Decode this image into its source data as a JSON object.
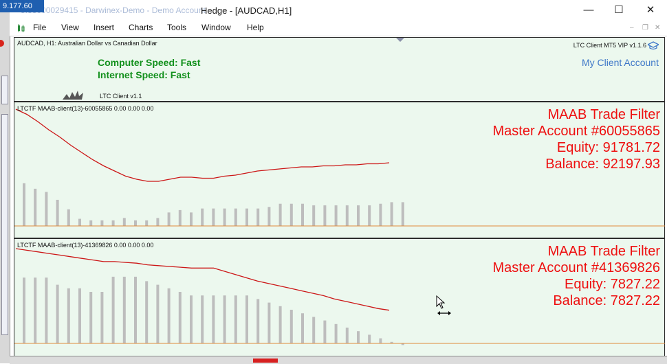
{
  "window": {
    "title": "Hedge - [AUDCAD,H1]",
    "background_caption": "5.33000029415 - Darwinex-Demo - Demo Account",
    "version_label": "9.177.60"
  },
  "menu": [
    "File",
    "View",
    "Insert",
    "Charts",
    "Tools",
    "Window",
    "Help"
  ],
  "top_panel": {
    "symbol": "AUDCAD, H1:  Australian Dollar vs Canadian Dollar",
    "client_version": "LTC Client MT5 VIP v1.1.6",
    "computer_speed": "Computer Speed: Fast",
    "internet_speed": "Internet Speed: Fast",
    "my_account_link": "My Client Account",
    "ltc_client": "LTC Client v1.1"
  },
  "subwindows": [
    {
      "indicator": "LTCTF MAAB-client(13)-60055865 0.00 0.00 0.00",
      "filter_title": "MAAB Trade Filter",
      "master": "Master Account #60055865",
      "equity": "Equity: 91781.72",
      "balance": "Balance: 92197.93"
    },
    {
      "indicator": "LTCTF MAAB-client(13)-41369826 0.00 0.00 0.00",
      "filter_title": "MAAB Trade Filter",
      "master": "Master Account #41369826",
      "equity": "Equity: 7827.22",
      "balance": "Balance: 7827.22"
    }
  ],
  "colors": {
    "panel_bg": "#ecf8ee",
    "red_text": "#ee1010",
    "green_text": "#12901c",
    "link_blue": "#3f78c8",
    "histogram": "#bdbdbd",
    "curve": "#cc1616",
    "level_line": "#e08a3a"
  },
  "chart_data": [
    {
      "type": "bar",
      "series": [
        {
          "values": [
            0.68,
            0.61,
            0.57,
            0.47,
            0.35,
            0.23,
            0.21,
            0.21,
            0.21,
            0.24,
            0.21,
            0.21,
            0.24,
            0.31,
            0.34,
            0.31,
            0.36,
            0.36,
            0.36,
            0.36,
            0.36,
            0.36,
            0.38,
            0.42,
            0.42,
            0.42,
            0.4,
            0.4,
            0.4,
            0.4,
            0.4,
            0.4,
            0.42,
            0.44,
            0.44
          ]
        },
        {
          "values": [
            1.0,
            0.95,
            0.88,
            0.8,
            0.73,
            0.65,
            0.58,
            0.51,
            0.45,
            0.4,
            0.35,
            0.32,
            0.3,
            0.3,
            0.32,
            0.34,
            0.34,
            0.33,
            0.33,
            0.35,
            0.36,
            0.38,
            0.4,
            0.41,
            0.42,
            0.43,
            0.44,
            0.44,
            0.45,
            0.45,
            0.46,
            0.46,
            0.47,
            0.47,
            0.48
          ]
        }
      ]
    },
    {
      "type": "bar",
      "series": [
        {
          "values": [
            0.86,
            0.86,
            0.86,
            0.78,
            0.74,
            0.74,
            0.7,
            0.7,
            0.87,
            0.87,
            0.87,
            0.82,
            0.78,
            0.74,
            0.7,
            0.66,
            0.66,
            0.66,
            0.66,
            0.66,
            0.66,
            0.62,
            0.58,
            0.54,
            0.5,
            0.46,
            0.42,
            0.38,
            0.34,
            0.3,
            0.26,
            0.22,
            0.18,
            0.14,
            0.12
          ]
        },
        {
          "values": [
            1.0,
            0.98,
            0.96,
            0.94,
            0.92,
            0.9,
            0.88,
            0.86,
            0.84,
            0.84,
            0.83,
            0.82,
            0.8,
            0.79,
            0.78,
            0.77,
            0.76,
            0.76,
            0.76,
            0.72,
            0.68,
            0.64,
            0.6,
            0.57,
            0.54,
            0.51,
            0.48,
            0.45,
            0.42,
            0.38,
            0.35,
            0.32,
            0.29,
            0.26,
            0.24
          ]
        }
      ]
    }
  ]
}
